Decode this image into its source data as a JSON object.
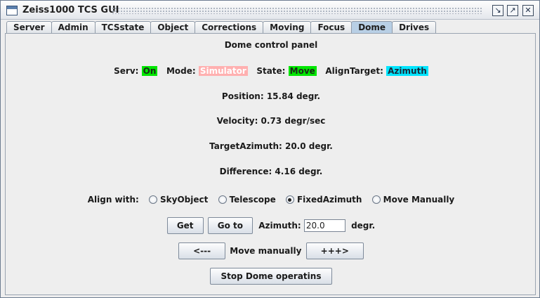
{
  "window": {
    "title": "Zeiss1000 TCS GUI"
  },
  "tabs": [
    "Server",
    "Admin",
    "TCSstate",
    "Object",
    "Corrections",
    "Moving",
    "Focus",
    "Dome",
    "Drives"
  ],
  "active_tab": "Dome",
  "panel": {
    "title": "Dome control panel",
    "status": {
      "serv_label": "Serv:",
      "serv_value": "On",
      "mode_label": "Mode:",
      "mode_value": "Simulator",
      "state_label": "State:",
      "state_value": "Move",
      "align_label": "AlignTarget:",
      "align_value": "Azimuth"
    },
    "position": "Position: 15.84 degr.",
    "velocity": "Velocity: 0.73 degr/sec",
    "target": "TargetAzimuth: 20.0 degr.",
    "difference": "Difference: 4.16 degr.",
    "align_with": {
      "label": "Align with:",
      "options": [
        "SkyObject",
        "Telescope",
        "FixedAzimuth",
        "Move Manually"
      ],
      "selected": "FixedAzimuth"
    },
    "goto_row": {
      "get": "Get",
      "goto": "Go to",
      "azimuth_label": "Azimuth:",
      "azimuth_value": "20.0",
      "unit": "degr."
    },
    "manual_row": {
      "left": "<---",
      "label": "Move manually",
      "right": "+++>"
    },
    "stop": "Stop Dome operatins"
  },
  "colors": {
    "on": "#00e600",
    "simulator": "#ffb0b0",
    "azimuth": "#00e5ff",
    "active_tab": "#b8cfe5"
  }
}
